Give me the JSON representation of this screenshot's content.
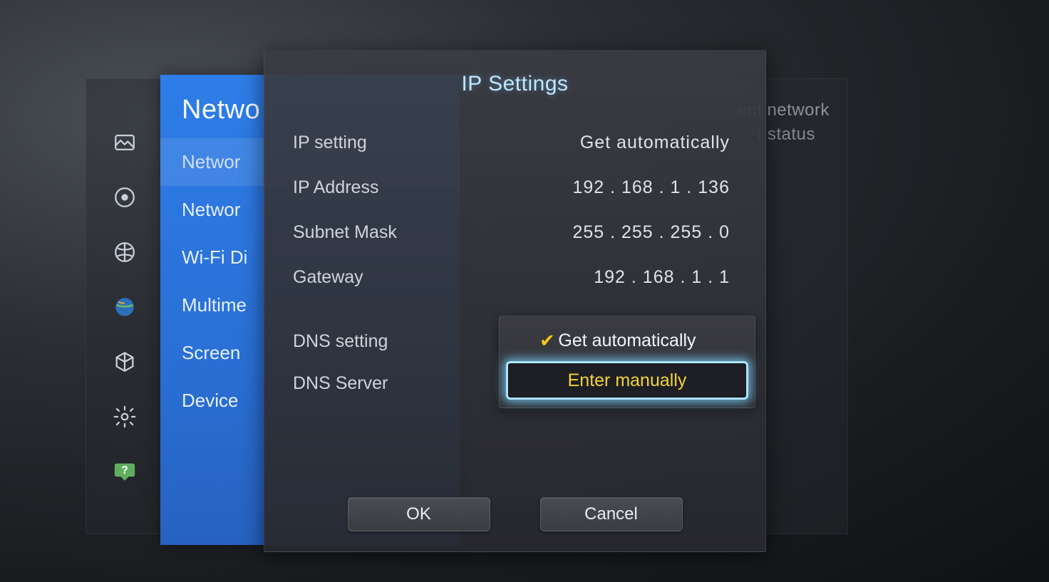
{
  "back_panel": {
    "line1": "ent network",
    "line2": "t status"
  },
  "sidebar": {
    "title": "Netwo",
    "items": [
      {
        "label": "Networ"
      },
      {
        "label": "Networ"
      },
      {
        "label": "Wi-Fi Di"
      },
      {
        "label": "Multime"
      },
      {
        "label": "Screen"
      },
      {
        "label": "Device"
      }
    ]
  },
  "dialog": {
    "title": "IP Settings",
    "rows": [
      {
        "label": "IP setting",
        "value": "Get automatically"
      },
      {
        "label": "IP Address",
        "value": "192 . 168 . 1 . 136"
      },
      {
        "label": "Subnet Mask",
        "value": "255 . 255 . 255 . 0"
      },
      {
        "label": "Gateway",
        "value": "192 . 168 . 1 . 1"
      }
    ],
    "dns_setting_label": "DNS setting",
    "dns_server_label": "DNS Server",
    "dropdown": {
      "option1": "Get automatically",
      "option2": "Enter manually"
    },
    "ok_label": "OK",
    "cancel_label": "Cancel"
  }
}
